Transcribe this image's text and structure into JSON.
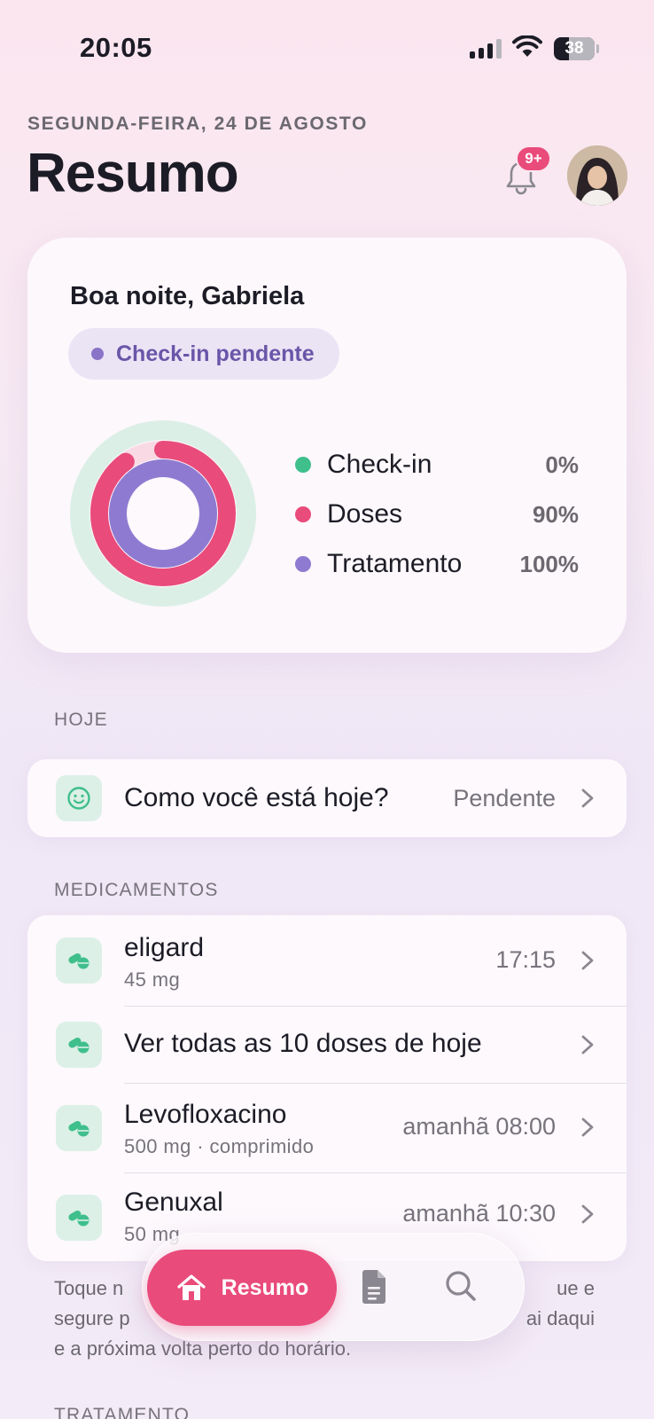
{
  "status_bar": {
    "time": "20:05",
    "battery": "38"
  },
  "header": {
    "date": "SEGUNDA-FEIRA, 24 DE AGOSTO",
    "title": "Resumo",
    "notifications_badge": "9+"
  },
  "summary": {
    "greeting": "Boa noite, Gabriela",
    "checkin_status": "Check-in pendente",
    "metrics": [
      {
        "name": "Check-in",
        "value": "0%",
        "fraction": 0.0,
        "color": "#3fbf8c"
      },
      {
        "name": "Doses",
        "value": "90%",
        "fraction": 0.9,
        "color": "#e94b7b"
      },
      {
        "name": "Tratamento",
        "value": "100%",
        "fraction": 1.0,
        "color": "#8e7bd1"
      }
    ]
  },
  "today": {
    "section_label": "HOJE",
    "checkin_row": {
      "title": "Como você está hoje?",
      "status": "Pendente",
      "icon": "smile-icon"
    }
  },
  "medications": {
    "section_label": "MEDICAMENTOS",
    "items": [
      {
        "name": "eligard",
        "detail": "45 mg",
        "time": "17:15",
        "icon": "pill-icon"
      },
      {
        "name": "Ver todas as 10 doses de hoje",
        "detail": "",
        "time": "",
        "icon": "pill-icon"
      },
      {
        "name": "Levofloxacino",
        "detail": "500 mg · comprimido",
        "time": "amanhã 08:00",
        "icon": "pill-icon"
      },
      {
        "name": "Genuxal",
        "detail": "50 mg",
        "time": "amanhã 10:30",
        "icon": "pill-icon"
      }
    ]
  },
  "footnote": {
    "line1": "Toque n",
    "line1_end": "ue e",
    "line2": "segure p",
    "line2_end": "ai daqui",
    "line3": "e a próxima volta perto do horário."
  },
  "treatment": {
    "section_label": "TRATAMENTO"
  },
  "tabbar": {
    "active_label": "Resumo",
    "tabs": [
      "house-icon",
      "document-icon",
      "search-icon"
    ]
  },
  "colors": {
    "accent": "#e94b7b",
    "checkin": "#3fbf8c",
    "treatment": "#8e7bd1"
  }
}
